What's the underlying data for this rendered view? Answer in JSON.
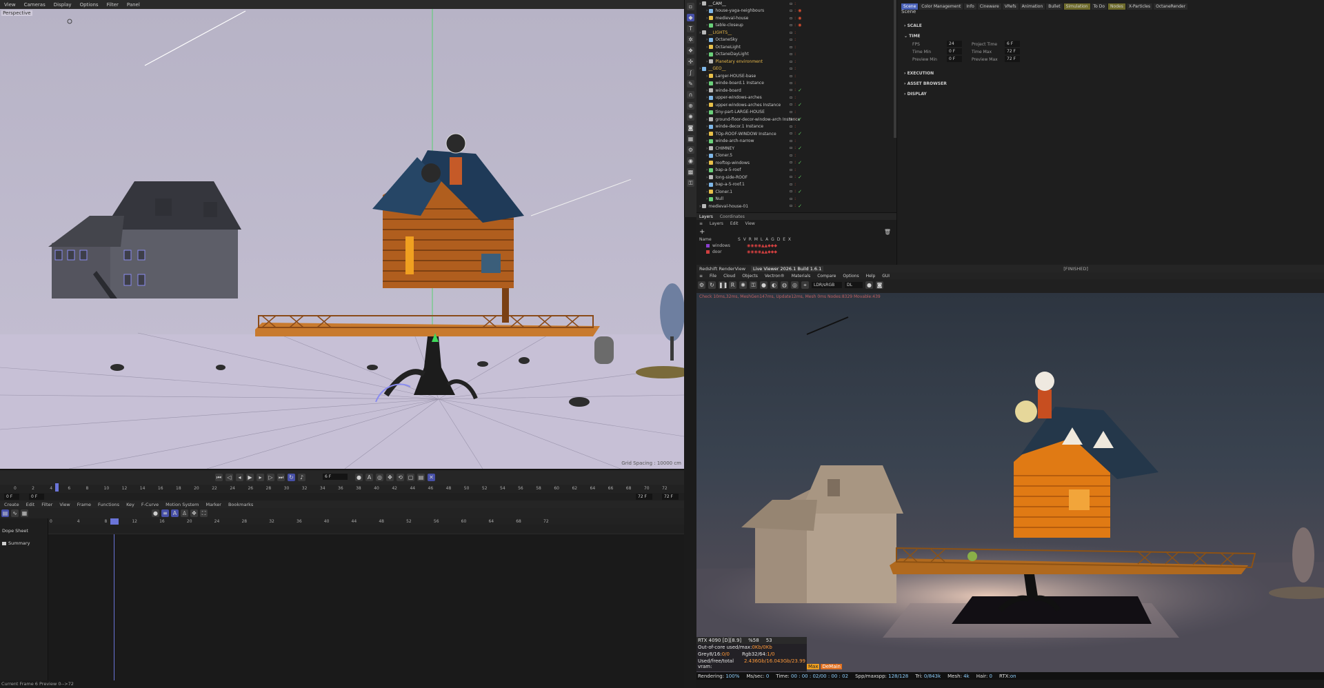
{
  "viewport": {
    "menu": [
      "View",
      "Cameras",
      "Display",
      "Options",
      "Filter",
      "Panel"
    ],
    "camera_label": "Perspective",
    "grid_spacing": "Grid Spacing : 10000 cm"
  },
  "timeline": {
    "current_frame": "6 F",
    "ruler_ticks": [
      "0",
      "2",
      "4",
      "6",
      "8",
      "10",
      "12",
      "14",
      "16",
      "18",
      "20",
      "22",
      "24",
      "26",
      "28",
      "30",
      "32",
      "34",
      "36",
      "38",
      "40",
      "42",
      "44",
      "46",
      "48",
      "50",
      "52",
      "54",
      "56",
      "58",
      "60",
      "62",
      "64",
      "66",
      "68",
      "70",
      "72"
    ],
    "range_start": "0 F",
    "range_start2": "0 F",
    "range_end": "72 F",
    "range_end2": "72 F"
  },
  "dopesheet": {
    "menu": [
      "Create",
      "Edit",
      "Filter",
      "View",
      "Frame",
      "Functions",
      "Key",
      "F-Curve",
      "Motion System",
      "Marker",
      "Bookmarks"
    ],
    "title": "Dope Sheet",
    "summary": "Summary",
    "ticks": [
      "0",
      "4",
      "8",
      "12",
      "16",
      "20",
      "24",
      "28",
      "32",
      "36",
      "40",
      "44",
      "48",
      "52",
      "56",
      "60",
      "64",
      "68",
      "72"
    ],
    "status": "Current Frame  6  Preview  0-->72"
  },
  "objects": [
    {
      "name": "__CAM__",
      "indent": 0,
      "color": "#e0e0e0"
    },
    {
      "name": "house-yaga-neighbours",
      "indent": 1,
      "color": "#c8c8c8"
    },
    {
      "name": "medieval-house",
      "indent": 1,
      "color": "#c8c8c8"
    },
    {
      "name": "table-closeup",
      "indent": 1,
      "color": "#c8c8c8"
    },
    {
      "name": "__LIGHTS__",
      "indent": 0,
      "color": "#e8b84a"
    },
    {
      "name": "OctaneSky",
      "indent": 1,
      "color": "#c8c8c8"
    },
    {
      "name": "OctaneLight",
      "indent": 1,
      "color": "#c8c8c8"
    },
    {
      "name": "OctaneDayLight",
      "indent": 1,
      "color": "#c8c8c8"
    },
    {
      "name": "Planetary environment",
      "indent": 1,
      "color": "#e8b84a"
    },
    {
      "name": "__GEO__",
      "indent": 0,
      "color": "#e8b84a"
    },
    {
      "name": "Larger-HOUSE-base",
      "indent": 1,
      "color": "#c8c8c8"
    },
    {
      "name": "winde-board.1 Instance",
      "indent": 1,
      "color": "#c8c8c8"
    },
    {
      "name": "winde-board",
      "indent": 1,
      "color": "#c8c8c8"
    },
    {
      "name": "upper-windows-arches",
      "indent": 1,
      "color": "#c8c8c8"
    },
    {
      "name": "upper-windows-arches Instance",
      "indent": 1,
      "color": "#c8c8c8"
    },
    {
      "name": "tiny-part-LARGE-HOUSE",
      "indent": 1,
      "color": "#c8c8c8"
    },
    {
      "name": "ground-floor-decor-window-arch Instance",
      "indent": 1,
      "color": "#c8c8c8"
    },
    {
      "name": "winde-decor.1 Instance",
      "indent": 1,
      "color": "#c8c8c8"
    },
    {
      "name": "TOp-ROOF-WINDOW Instance",
      "indent": 1,
      "color": "#c8c8c8"
    },
    {
      "name": "winde-arch-narrow",
      "indent": 1,
      "color": "#c8c8c8"
    },
    {
      "name": "CHIMNEY",
      "indent": 1,
      "color": "#c8c8c8"
    },
    {
      "name": "Cloner.5",
      "indent": 1,
      "color": "#c8c8c8"
    },
    {
      "name": "rooftop-windows",
      "indent": 1,
      "color": "#c8c8c8"
    },
    {
      "name": "bap-a-5-roof",
      "indent": 1,
      "color": "#c8c8c8"
    },
    {
      "name": "long-side-ROOF",
      "indent": 1,
      "color": "#c8c8c8"
    },
    {
      "name": "bap-a-5-roof.1",
      "indent": 1,
      "color": "#c8c8c8"
    },
    {
      "name": "Cloner.1",
      "indent": 1,
      "color": "#c8c8c8"
    },
    {
      "name": "Null",
      "indent": 1,
      "color": "#c8c8c8"
    },
    {
      "name": "medieval-house-01",
      "indent": 0,
      "color": "#c8c8c8"
    }
  ],
  "layers": {
    "tabs": [
      "Layers",
      "Coordinates"
    ],
    "menu": [
      "Layers",
      "Edit",
      "View"
    ],
    "header_name": "Name",
    "header_flags": "S V R M L A G D E X",
    "items": [
      {
        "name": "windows",
        "color": "#8a3fd0"
      },
      {
        "name": "door",
        "color": "#d03f3f"
      }
    ]
  },
  "attributes": {
    "tabs": [
      "Scene",
      "Color Management",
      "Info",
      "Cineware",
      "VRefs",
      "Animation",
      "Bullet",
      "Simulation",
      "To Do",
      "Nodes",
      "X-Particles",
      "OctaneRender"
    ],
    "active_tab": "Scene",
    "title": "Scene",
    "sections": [
      "SCALE",
      "TIME",
      "EXECUTION",
      "ASSET BROWSER",
      "DISPLAY"
    ],
    "fields": [
      {
        "label": "FPS",
        "value": "24"
      },
      {
        "label": "Project Time",
        "value": "6 F"
      },
      {
        "label": "Time Min",
        "value": "0 F"
      },
      {
        "label": "Time Max",
        "value": "72 F"
      },
      {
        "label": "Preview Min",
        "value": "0 F"
      },
      {
        "label": "Preview Max",
        "value": "72 F"
      }
    ]
  },
  "render": {
    "tabs": [
      "Redshift RenderView",
      "Live Viewer 2026.1 Build 1.6.1"
    ],
    "status_finished": "[FINISHED]",
    "menu": [
      "File",
      "Cloud",
      "Objects",
      "Vectron®",
      "Materials",
      "Compare",
      "Options",
      "Help",
      "GUI"
    ],
    "color_mode": "LDR/sRGB",
    "channel": "DL",
    "info_line": "Check 10ms,32ms, MeshGen147ms, Update12ms, Mesh 0ms Nodes:8329 Movable:439",
    "stats": {
      "gpu": "RTX 4090 [D][8.9]",
      "pct": "%58",
      "temp": "53",
      "ooc": "Out-of-core used/max:",
      "ooc_val": "0Kb/0Kb",
      "grey": "Grey8/16:",
      "grey_val": "0/0",
      "rgb": "Rgb32/64:",
      "rgb_val": "1/0",
      "vram": "Used/free/total vram:",
      "vram_val": "2.436Gb/16.043Gb/23.99",
      "tag1": "Max",
      "tag2": "DeMain"
    },
    "status": {
      "rendering_label": "Rendering:",
      "rendering": "100%",
      "ms_label": "Ms/sec:",
      "ms": "0",
      "time_label": "Time:",
      "time": "00 : 00 : 02/00 : 00 : 02",
      "spp_label": "Spp/maxspp:",
      "spp": "128/128",
      "tri_label": "Tri:",
      "tri": "0/843k",
      "mesh_label": "Mesh:",
      "mesh": "4k",
      "hair_label": "Hair:",
      "hair": "0",
      "rtx_label": "RTX:",
      "rtx": "on"
    }
  }
}
